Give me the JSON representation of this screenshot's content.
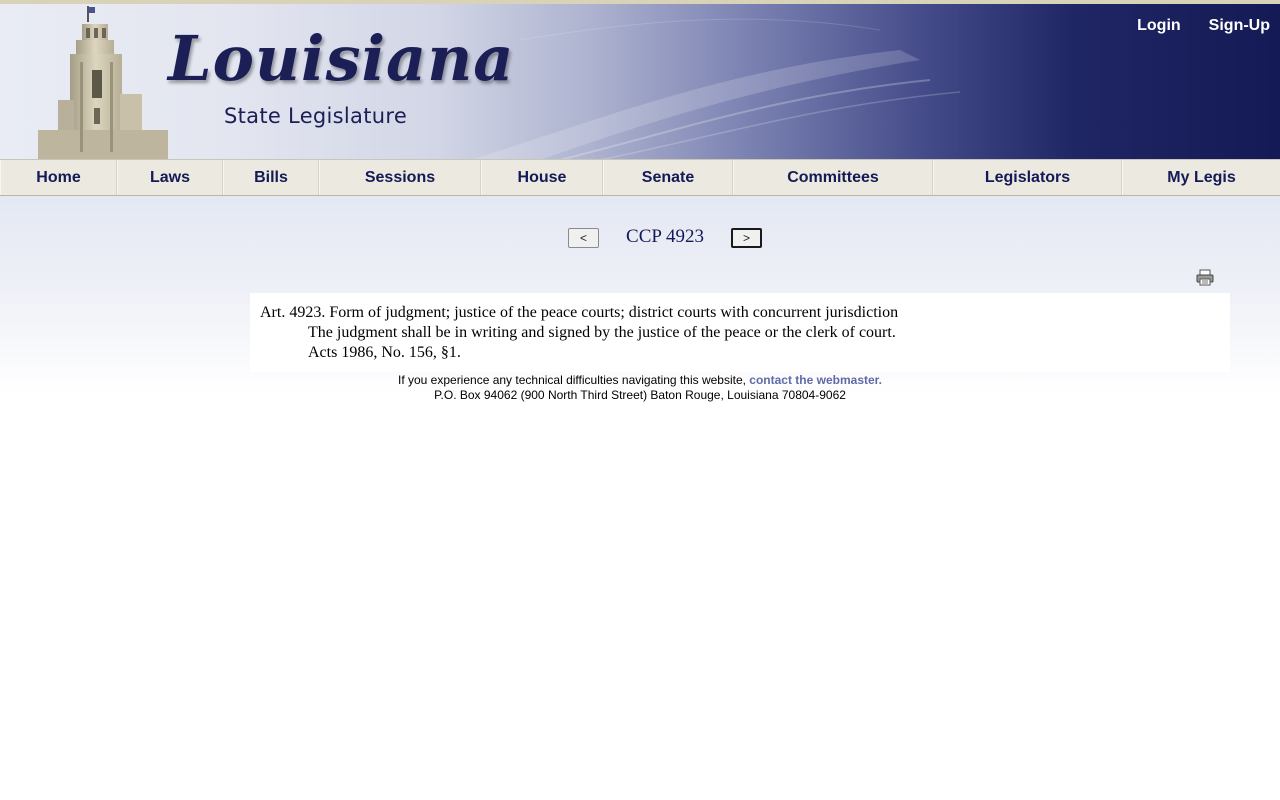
{
  "header": {
    "logo_title": "Louisiana",
    "logo_subtitle": "State Legislature",
    "login_label": "Login",
    "signup_label": "Sign-Up"
  },
  "nav": {
    "items": [
      {
        "label": "Home"
      },
      {
        "label": "Laws"
      },
      {
        "label": "Bills"
      },
      {
        "label": "Sessions"
      },
      {
        "label": "House"
      },
      {
        "label": "Senate"
      },
      {
        "label": "Committees"
      },
      {
        "label": "Legislators"
      },
      {
        "label": "My Legis"
      }
    ]
  },
  "pager": {
    "prev_label": "<",
    "next_label": ">",
    "title": "CCP 4923"
  },
  "law": {
    "heading": "Art. 4923.  Form of judgment; justice of the peace courts; district courts with concurrent jurisdiction",
    "body": "The judgment shall be in writing and signed by the justice of the peace or the clerk of court.",
    "history": "Acts 1986, No. 156, §1."
  },
  "footer": {
    "line1_text": "If you experience any technical difficulties navigating this website, ",
    "line1_link": "contact the webmaster.",
    "line2": "P.O. Box 94062 (900 North Third Street) Baton Rouge, Louisiana 70804-9062"
  },
  "colors": {
    "brand_navy": "#141a55",
    "link": "#5f6aa6",
    "nav_bg": "#ebe9e0"
  },
  "icons": {
    "print": "print-icon"
  }
}
